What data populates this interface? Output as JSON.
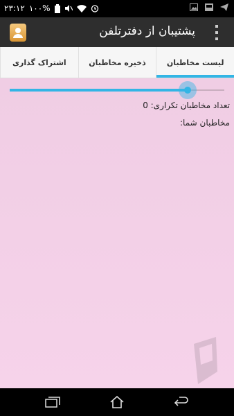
{
  "status_bar": {
    "time": "۲۳:۱۲",
    "battery": "۱۰۰%",
    "icons": [
      "alarm-icon",
      "wifi-icon",
      "mute-icon",
      "battery-icon",
      "image-icon",
      "telegram-icon",
      "notification-icon"
    ]
  },
  "action_bar": {
    "title": "پشتیبان از دفترتلفن",
    "app_icon": "contacts-app-icon",
    "menu_icon": "overflow-menu-icon"
  },
  "tabs": [
    {
      "label": "لیست مخاطبان",
      "active": true
    },
    {
      "label": "ذخیره مخاطبان",
      "active": false
    },
    {
      "label": "اشتراک گذاری",
      "active": false
    }
  ],
  "slider": {
    "value": 0.83,
    "color": "#33b5e5"
  },
  "content": {
    "duplicate_label": "تعداد مخاطبان تکراری: 0",
    "contacts_label": "مخاطبان شما:"
  },
  "nav_bar": {
    "icons": [
      "recent-apps-icon",
      "home-icon",
      "back-icon"
    ]
  },
  "colors": {
    "accent": "#33b5e5",
    "background": "#f3d0e7",
    "action_bar": "#2e2e2e"
  }
}
